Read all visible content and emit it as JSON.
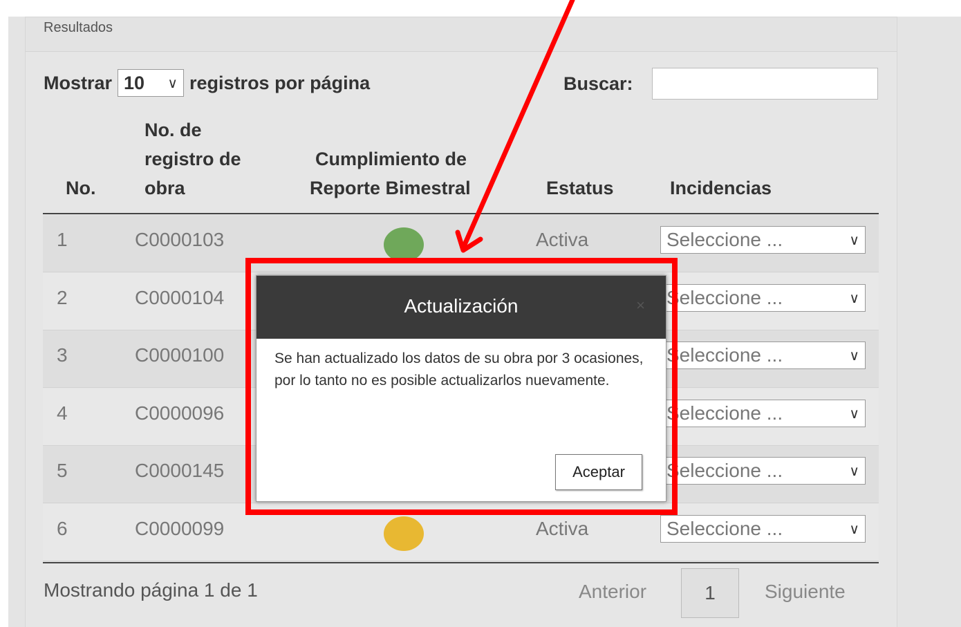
{
  "panel": {
    "title": "Resultados"
  },
  "controls": {
    "show_label": "Mostrar",
    "page_size": "10",
    "per_page_label": "registros por página",
    "search_label": "Buscar:",
    "search_value": ""
  },
  "table": {
    "headers": {
      "no": "No.",
      "registro_line1": "No. de",
      "registro_line2": "registro de",
      "registro_line3": "obra",
      "cumplimiento_line1": "Cumplimiento de",
      "cumplimiento_line2": "Reporte Bimestral",
      "estatus": "Estatus",
      "incidencias": "Incidencias"
    },
    "rows": [
      {
        "no": "1",
        "registro": "C0000103",
        "indicator": "green-dot",
        "indicator_color": "#6fa85a",
        "estatus": "Activa",
        "incidencia": "Seleccione ..."
      },
      {
        "no": "2",
        "registro": "C0000104",
        "indicator": "",
        "indicator_color": "",
        "estatus": "",
        "incidencia": "Seleccione ..."
      },
      {
        "no": "3",
        "registro": "C0000100",
        "indicator": "",
        "indicator_color": "",
        "estatus": "",
        "incidencia": "Seleccione ..."
      },
      {
        "no": "4",
        "registro": "C0000096",
        "indicator": "",
        "indicator_color": "",
        "estatus": "",
        "incidencia": "Seleccione ..."
      },
      {
        "no": "5",
        "registro": "C0000145",
        "indicator": "",
        "indicator_color": "",
        "estatus": "",
        "incidencia": "Seleccione ..."
      },
      {
        "no": "6",
        "registro": "C0000099",
        "indicator": "yellow-dot",
        "indicator_color": "#e8b832",
        "estatus": "Activa",
        "incidencia": "Seleccione ..."
      }
    ]
  },
  "footer": {
    "info": "Mostrando página 1 de 1",
    "prev": "Anterior",
    "page": "1",
    "next": "Siguiente"
  },
  "modal": {
    "title": "Actualización",
    "close": "×",
    "message": "Se han actualizado los datos de su obra por 3 ocasiones, por lo tanto no es posible actualizarlos nuevamente.",
    "accept": "Aceptar"
  },
  "colors": {
    "modal_header": "#3a3a3a",
    "highlight": "#ff0000",
    "panel_bg": "#e6e6e6"
  },
  "icons": {
    "select_chevron": "chevron-down-icon",
    "annotation_arrow": "red-arrow-annotation",
    "modal_close": "close-icon"
  }
}
